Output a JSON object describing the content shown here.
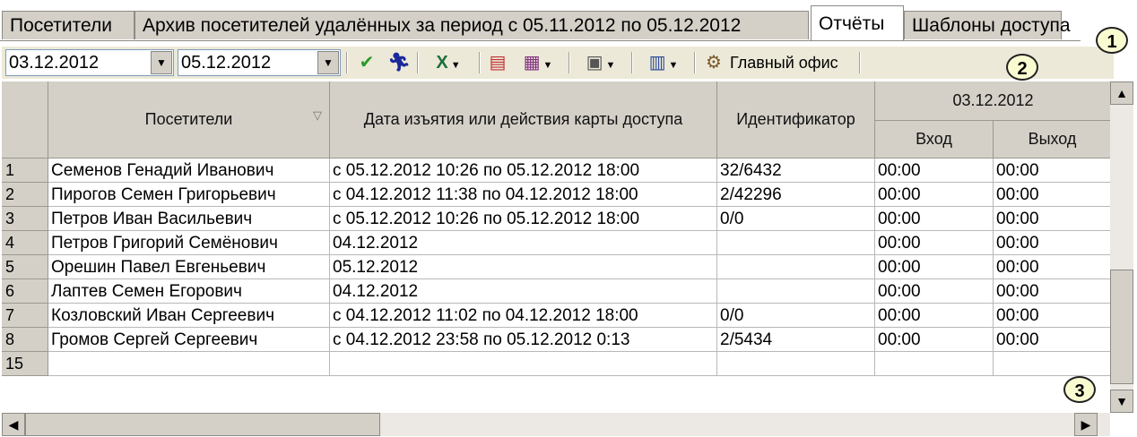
{
  "tabs": [
    {
      "label": "Посетители"
    },
    {
      "label": "Архив посетителей удалённых за период с 05.11.2012 по 05.12.2012"
    },
    {
      "label": "Отчёты",
      "active": true
    },
    {
      "label": "Шаблоны доступа"
    }
  ],
  "toolbar": {
    "date_from": "03.12.2012",
    "date_to": "05.12.2012",
    "location": "Главный офис",
    "icons": [
      "checkmark-icon",
      "running-person-icon",
      "excel-export-icon",
      "report-icon",
      "calendar-icon",
      "settings-icon",
      "layout-icon",
      "office-icon"
    ]
  },
  "grid": {
    "columns": {
      "visitor": "Посетители",
      "date": "Дата изъятия или действия карты доступа",
      "id": "Идентификатор",
      "day": "03.12.2012",
      "in": "Вход",
      "out": "Выход"
    },
    "rows": [
      {
        "n": "1",
        "name": "Семенов Генадий Иванович",
        "date": "с 05.12.2012 10:26 по 05.12.2012 18:00",
        "id": "32/6432",
        "in": "00:00",
        "out": "00:00"
      },
      {
        "n": "2",
        "name": "Пирогов Семен Григорьевич",
        "date": "с 04.12.2012 11:38 по 04.12.2012 18:00",
        "id": "2/42296",
        "in": "00:00",
        "out": "00:00"
      },
      {
        "n": "3",
        "name": "Петров Иван Васильевич",
        "date": "с 05.12.2012 10:26 по 05.12.2012 18:00",
        "id": "0/0",
        "in": "00:00",
        "out": "00:00"
      },
      {
        "n": "4",
        "name": "Петров Григорий Семёнович",
        "date": "04.12.2012",
        "id": "",
        "in": "00:00",
        "out": "00:00"
      },
      {
        "n": "5",
        "name": "Орешин Павел Евгеньевич",
        "date": "05.12.2012",
        "id": "",
        "in": "00:00",
        "out": "00:00"
      },
      {
        "n": "6",
        "name": "Лаптев Семен Егорович",
        "date": "04.12.2012",
        "id": "",
        "in": "00:00",
        "out": "00:00"
      },
      {
        "n": "7",
        "name": "Козловский Иван Сергеевич",
        "date": "с 04.12.2012 11:02 по 04.12.2012 18:00",
        "id": "0/0",
        "in": "00:00",
        "out": "00:00"
      },
      {
        "n": "8",
        "name": "Громов Сергей Сергеевич",
        "date": "с 04.12.2012 23:58 по 05.12.2012 0:13",
        "id": "2/5434",
        "in": "00:00",
        "out": "00:00"
      },
      {
        "n": "15",
        "name": "",
        "date": "",
        "id": "",
        "in": "",
        "out": ""
      }
    ]
  },
  "callouts": [
    "1",
    "2",
    "3"
  ]
}
